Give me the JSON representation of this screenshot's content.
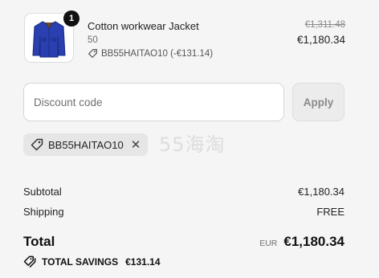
{
  "product": {
    "name": "Cotton workwear Jacket",
    "variant": "50",
    "discount_code_line": "BB55HAITAO10 (-€131.14)",
    "quantity": "1",
    "original_price": "€1,311.48",
    "price": "€1,180.34"
  },
  "discount": {
    "placeholder": "Discount code",
    "apply_label": "Apply",
    "applied_code": "BB55HAITAO10"
  },
  "watermark": "55海淘",
  "summary": {
    "subtotal_label": "Subtotal",
    "subtotal_value": "€1,180.34",
    "shipping_label": "Shipping",
    "shipping_value": "FREE",
    "total_label": "Total",
    "currency": "EUR",
    "total_value": "€1,180.34",
    "savings_label": "TOTAL SAVINGS",
    "savings_value": "€131.14"
  },
  "icons": {
    "thumbnail": "jacket-thumbnail",
    "tag": "tag-icon",
    "remove": "close-icon",
    "savings": "tags-icon"
  },
  "colors": {
    "background": "#f5f5f5",
    "jacket": "#2a3fb0",
    "badge": "#111111"
  }
}
